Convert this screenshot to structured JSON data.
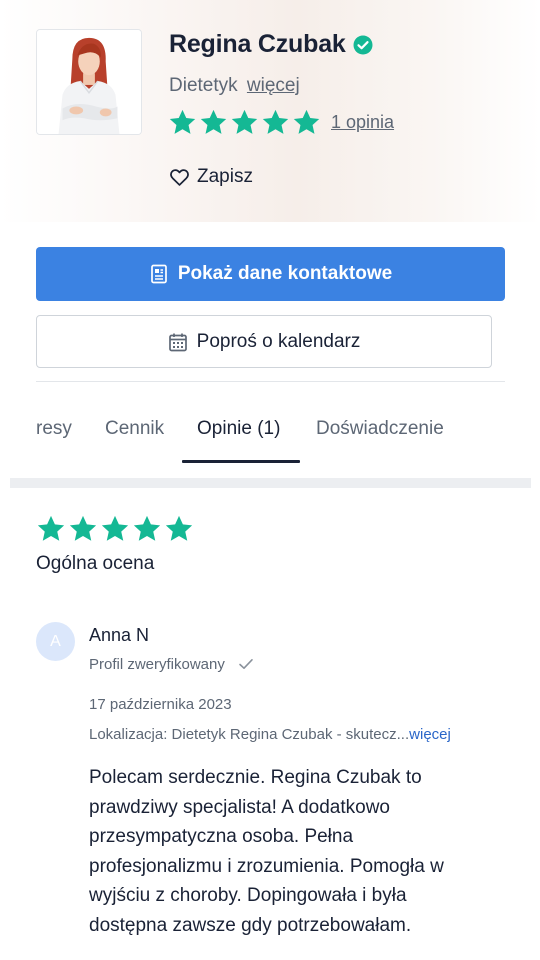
{
  "profile": {
    "name": "Regina Czubak",
    "specialty": "Dietetyk",
    "specialty_more": "więcej",
    "rating": 5,
    "reviews_link": "1 opinia",
    "save_label": "Zapisz"
  },
  "actions": {
    "show_contact": "Pokaż dane kontaktowe",
    "ask_calendar": "Poproś o kalendarz"
  },
  "tabs": [
    {
      "label": "resy"
    },
    {
      "label": "Cennik"
    },
    {
      "label": "Opinie (1)",
      "active": true
    },
    {
      "label": "Doświadczenie"
    }
  ],
  "overall": {
    "rating": 5,
    "label": "Ogólna ocena"
  },
  "review": {
    "avatar_initial": "A",
    "author": "Anna N",
    "verified_label": "Profil zweryfikowany",
    "date": "17 października 2023",
    "location": "Lokalizacja: Dietetyk Regina Czubak - skutecz...",
    "location_more": "więcej",
    "text_lines": [
      "Polecam serdecznie. Regina Czubak to",
      "prawdziwy specjalista! A dodatkowo",
      "przesympatyczna osoba. Pełna",
      "profesjonalizmu i zrozumienia. Pomogła w",
      "wyjściu z choroby. Dopingowała i była",
      "dostępna zawsze gdy potrzebowałam."
    ]
  },
  "colors": {
    "accent": "#3b82e2",
    "star": "#14b894",
    "verified_badge": "#14b894",
    "text_primary": "#1a2236",
    "text_secondary": "#5d6775",
    "link": "#2a66c8"
  },
  "icons": {
    "verified": "verified-check-icon",
    "star": "star-icon",
    "save": "heart-outline-icon",
    "contact": "address-card-icon",
    "calendar": "calendar-icon",
    "verified_profile": "check-icon"
  }
}
